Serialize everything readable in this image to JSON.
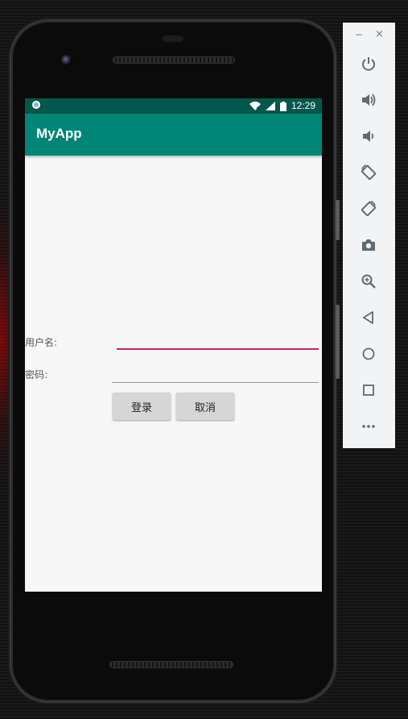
{
  "status_bar": {
    "time": "12:29"
  },
  "app_bar": {
    "title": "MyApp"
  },
  "form": {
    "username_label": "用户名:",
    "username_value": "",
    "password_label": "密码:",
    "password_value": "",
    "login_button": "登录",
    "cancel_button": "取消"
  },
  "colors": {
    "app_bar": "#008577",
    "status_bar": "#00574b",
    "accent": "#d81b60"
  },
  "emulator_panel": {
    "minimize_label": "−",
    "close_label": "×",
    "icons": [
      "power-icon",
      "volume-up-icon",
      "volume-down-icon",
      "rotate-left-icon",
      "rotate-right-icon",
      "camera-icon",
      "zoom-icon",
      "back-icon",
      "home-icon",
      "overview-icon",
      "more-icon"
    ]
  }
}
